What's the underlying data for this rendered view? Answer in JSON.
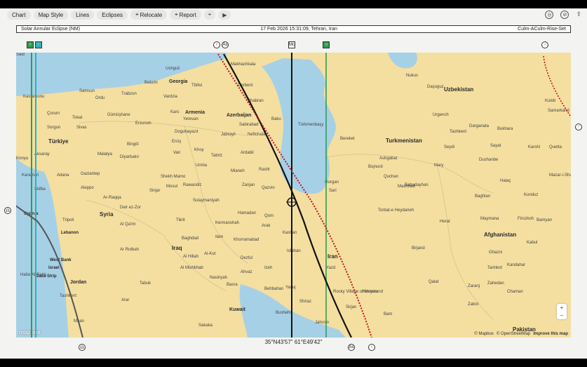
{
  "toolbar": {
    "chart": "Chart",
    "map_style": "Map Style",
    "lines": "Lines",
    "eclipses": "Eclipses",
    "relocate": "Relocate",
    "report": "Report"
  },
  "info": {
    "left": "Solar Annular Eclipse (NM)",
    "center": "17 Feb 2026 15:31:09, Tehran, Iran",
    "right": "Culm-ACulm-Rise-Set"
  },
  "countries": {
    "uzbekistan": "Uzbekistan",
    "georgia": "Georgia",
    "armenia": "Armenia",
    "azerbaijan": "Azerbaijan",
    "turkmenistan": "Turkmenistan",
    "turkiye": "Türkiye",
    "syria": "Syria",
    "lebanon": "Lebanon",
    "iraq": "Iraq",
    "iran": "Iran",
    "afghanistan": "Afghanistan",
    "israel": "Israel",
    "jordan": "Jordan",
    "kuwait": "Kuwait",
    "pakistan": "Pakistan",
    "cyprus": "Cyprus",
    "west_bank": "West Bank",
    "gaza": "Gaza Strip"
  },
  "places": [
    {
      "name": "Ushguli"
    },
    {
      "name": "Batumi"
    },
    {
      "name": "Trabzon"
    },
    {
      "name": "Samsun"
    },
    {
      "name": "Ordu"
    },
    {
      "name": "Kastamonu"
    },
    {
      "name": "Çorum"
    },
    {
      "name": "Tokat"
    },
    {
      "name": "Gümüşhane"
    },
    {
      "name": "Erzurum"
    },
    {
      "name": "Sorgun"
    },
    {
      "name": "Sivas"
    },
    {
      "name": "Kars"
    },
    {
      "name": "Yerevan"
    },
    {
      "name": "Tbilisi"
    },
    {
      "name": "Vardzia"
    },
    {
      "name": "Bingöl"
    },
    {
      "name": "Malatya"
    },
    {
      "name": "Diyarbakır"
    },
    {
      "name": "Van"
    },
    {
      "name": "Khoy"
    },
    {
      "name": "Tabriz"
    },
    {
      "name": "Ardabil"
    },
    {
      "name": "Aksaray"
    },
    {
      "name": "Konya"
    },
    {
      "name": "Karaman"
    },
    {
      "name": "Adana"
    },
    {
      "name": "Gaziantep"
    },
    {
      "name": "Silifke"
    },
    {
      "name": "Aleppo"
    },
    {
      "name": "Ar-Raqqa"
    },
    {
      "name": "Deir ez-Zor"
    },
    {
      "name": "Sinjar"
    },
    {
      "name": "Mosul"
    },
    {
      "name": "Rawandiz"
    },
    {
      "name": "Shekh Mamo"
    },
    {
      "name": "Sulaymaniyah"
    },
    {
      "name": "Tripoli"
    },
    {
      "name": "Al Qa'im"
    },
    {
      "name": "Tikrit"
    },
    {
      "name": "Baghdad"
    },
    {
      "name": "Ar Rutbah"
    },
    {
      "name": "Al Hillah"
    },
    {
      "name": "Al-Kut"
    },
    {
      "name": "Al Mishkhab"
    },
    {
      "name": "Nasiriyah"
    },
    {
      "name": "Basra"
    },
    {
      "name": "Dezful"
    },
    {
      "name": "Ahvaz"
    },
    {
      "name": "Kermanshah"
    },
    {
      "name": "Hamadan"
    },
    {
      "name": "Khorramabad"
    },
    {
      "name": "Ilam"
    },
    {
      "name": "Zanjan"
    },
    {
      "name": "Mianeh"
    },
    {
      "name": "Rasht"
    },
    {
      "name": "Qazvin"
    },
    {
      "name": "Arak"
    },
    {
      "name": "Qom"
    },
    {
      "name": "Kashan"
    },
    {
      "name": "Isfahan"
    },
    {
      "name": "Izeh"
    },
    {
      "name": "Behbahan"
    },
    {
      "name": "Yasuj"
    },
    {
      "name": "Shiraz"
    },
    {
      "name": "Bushehr"
    },
    {
      "name": "Jahrom"
    },
    {
      "name": "Yazd"
    },
    {
      "name": "Kerman"
    },
    {
      "name": "Sirjan"
    },
    {
      "name": "Bam"
    },
    {
      "name": "Rocky Village of Meymand"
    },
    {
      "name": "Derbent"
    },
    {
      "name": "Makhachkala"
    },
    {
      "name": "Shabran"
    },
    {
      "name": "Sabirabad"
    },
    {
      "name": "Baku"
    },
    {
      "name": "Jabrayil"
    },
    {
      "name": "Neftchala"
    },
    {
      "name": "Dogubayazıt"
    },
    {
      "name": "Erciş"
    },
    {
      "name": "Urmia"
    },
    {
      "name": "Türkmenbaşy"
    },
    {
      "name": "Bereket"
    },
    {
      "name": "Ashgabat"
    },
    {
      "name": "Bojnurd"
    },
    {
      "name": "Quchan"
    },
    {
      "name": "Mashhad"
    },
    {
      "name": "Sari"
    },
    {
      "name": "Gorgan"
    },
    {
      "name": "Torbat-e Heydarieh"
    },
    {
      "name": "Birjand"
    },
    {
      "name": "Herat"
    },
    {
      "name": "Babadayhan"
    },
    {
      "name": "Mary"
    },
    {
      "name": "Daşoguz"
    },
    {
      "name": "Nukus"
    },
    {
      "name": "Urgench"
    },
    {
      "name": "Darganata"
    },
    {
      "name": "Bukhara"
    },
    {
      "name": "Samarkand"
    },
    {
      "name": "Tashkent"
    },
    {
      "name": "Seydi"
    },
    {
      "name": "Sayat"
    },
    {
      "name": "Karshi"
    },
    {
      "name": "Dushanbe"
    },
    {
      "name": "Halaç"
    },
    {
      "name": "Mazar-i-Sharif"
    },
    {
      "name": "Kunduz"
    },
    {
      "name": "Baghlan"
    },
    {
      "name": "Maymana"
    },
    {
      "name": "Firozkoh"
    },
    {
      "name": "Bamyan"
    },
    {
      "name": "Kabul"
    },
    {
      "name": "Ghazni"
    },
    {
      "name": "Tarinkot"
    },
    {
      "name": "Kandahar"
    },
    {
      "name": "Qalat"
    },
    {
      "name": "Zaranj"
    },
    {
      "name": "Zabol"
    },
    {
      "name": "Zahedan"
    },
    {
      "name": "Chaman"
    },
    {
      "name": "Quetta"
    },
    {
      "name": "Kulob"
    },
    {
      "name": "Tashkent"
    },
    {
      "name": "Maan"
    },
    {
      "name": "Tabuk"
    },
    {
      "name": "Arar"
    },
    {
      "name": "Sakaka"
    },
    {
      "name": "Hafar Al-Batin"
    },
    {
      "name": "Said"
    }
  ],
  "seas": [
    "Mediterranean"
  ],
  "line_labels": {
    "top_left_a": "♆",
    "top_left_b": "♇",
    "asc_top": "As",
    "mc_top": "Mc",
    "jup_top": "♃",
    "ven_top": "♀",
    "mars_top": "♂",
    "right_mars": "♂",
    "left_node": "☊",
    "bottom_node": "☊",
    "bottom_asc": "As",
    "bottom_ven": "♀"
  },
  "attribution": {
    "mapbox": "© Mapbox",
    "osm": "© OpenStreetMap",
    "improve": "Improve this map"
  },
  "logo": "mapbox",
  "coords": "35°N43'57\"  61°E49'42\"",
  "colors": {
    "land": "#f4dfa0",
    "water": "#a6d0e6",
    "green_line": "#2e9d52",
    "teal_line": "#30b0b8",
    "red_dotted": "#c0161d",
    "black_line": "#111111",
    "grey_line": "#555555"
  }
}
